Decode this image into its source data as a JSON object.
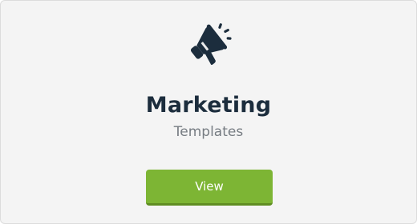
{
  "card": {
    "icon": "megaphone-icon",
    "title": "Marketing",
    "subtitle": "Templates",
    "button_label": "View"
  },
  "colors": {
    "background": "#f4f4f4",
    "title": "#1c2d3d",
    "subtitle": "#767c82",
    "button": "#7db534",
    "icon": "#1c2d3d"
  }
}
